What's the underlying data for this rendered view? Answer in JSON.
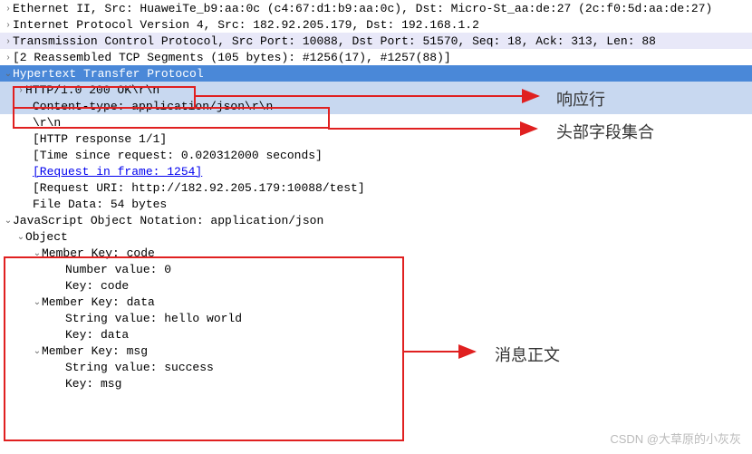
{
  "packets": {
    "ethernet": "Ethernet II, Src: HuaweiTe_b9:aa:0c (c4:67:d1:b9:aa:0c), Dst: Micro-St_aa:de:27 (2c:f0:5d:aa:de:27)",
    "ip": "Internet Protocol Version 4, Src: 182.92.205.179, Dst: 192.168.1.2",
    "tcp": "Transmission Control Protocol, Src Port: 10088, Dst Port: 51570, Seq: 18, Ack: 313, Len: 88",
    "reassembled": "[2 Reassembled TCP Segments (105 bytes): #1256(17), #1257(88)]"
  },
  "http": {
    "title": "Hypertext Transfer Protocol",
    "status_line": "HTTP/1.0 200 OK\\r\\n",
    "content_type": "Content-type: application/json\\r\\n",
    "crlf": "\\r\\n",
    "response_num": "[HTTP response 1/1]",
    "time_since": "[Time since request: 0.020312000 seconds]",
    "request_frame": "[Request in frame: 1254]",
    "request_uri": "[Request URI: http://182.92.205.179:10088/test]",
    "file_data": "File Data: 54 bytes"
  },
  "json": {
    "title": "JavaScript Object Notation: application/json",
    "object": "Object",
    "members": [
      {
        "mkey": "Member Key: code",
        "valline": "Number value: 0",
        "keyline": "Key: code"
      },
      {
        "mkey": "Member Key: data",
        "valline": "String value: hello world",
        "keyline": "Key: data"
      },
      {
        "mkey": "Member Key: msg",
        "valline": "String value: success",
        "keyline": "Key: msg"
      }
    ]
  },
  "annotations": {
    "label1": "响应行",
    "label2": "头部字段集合",
    "label3": "消息正文"
  },
  "watermark": "CSDN @大草原的小灰灰"
}
